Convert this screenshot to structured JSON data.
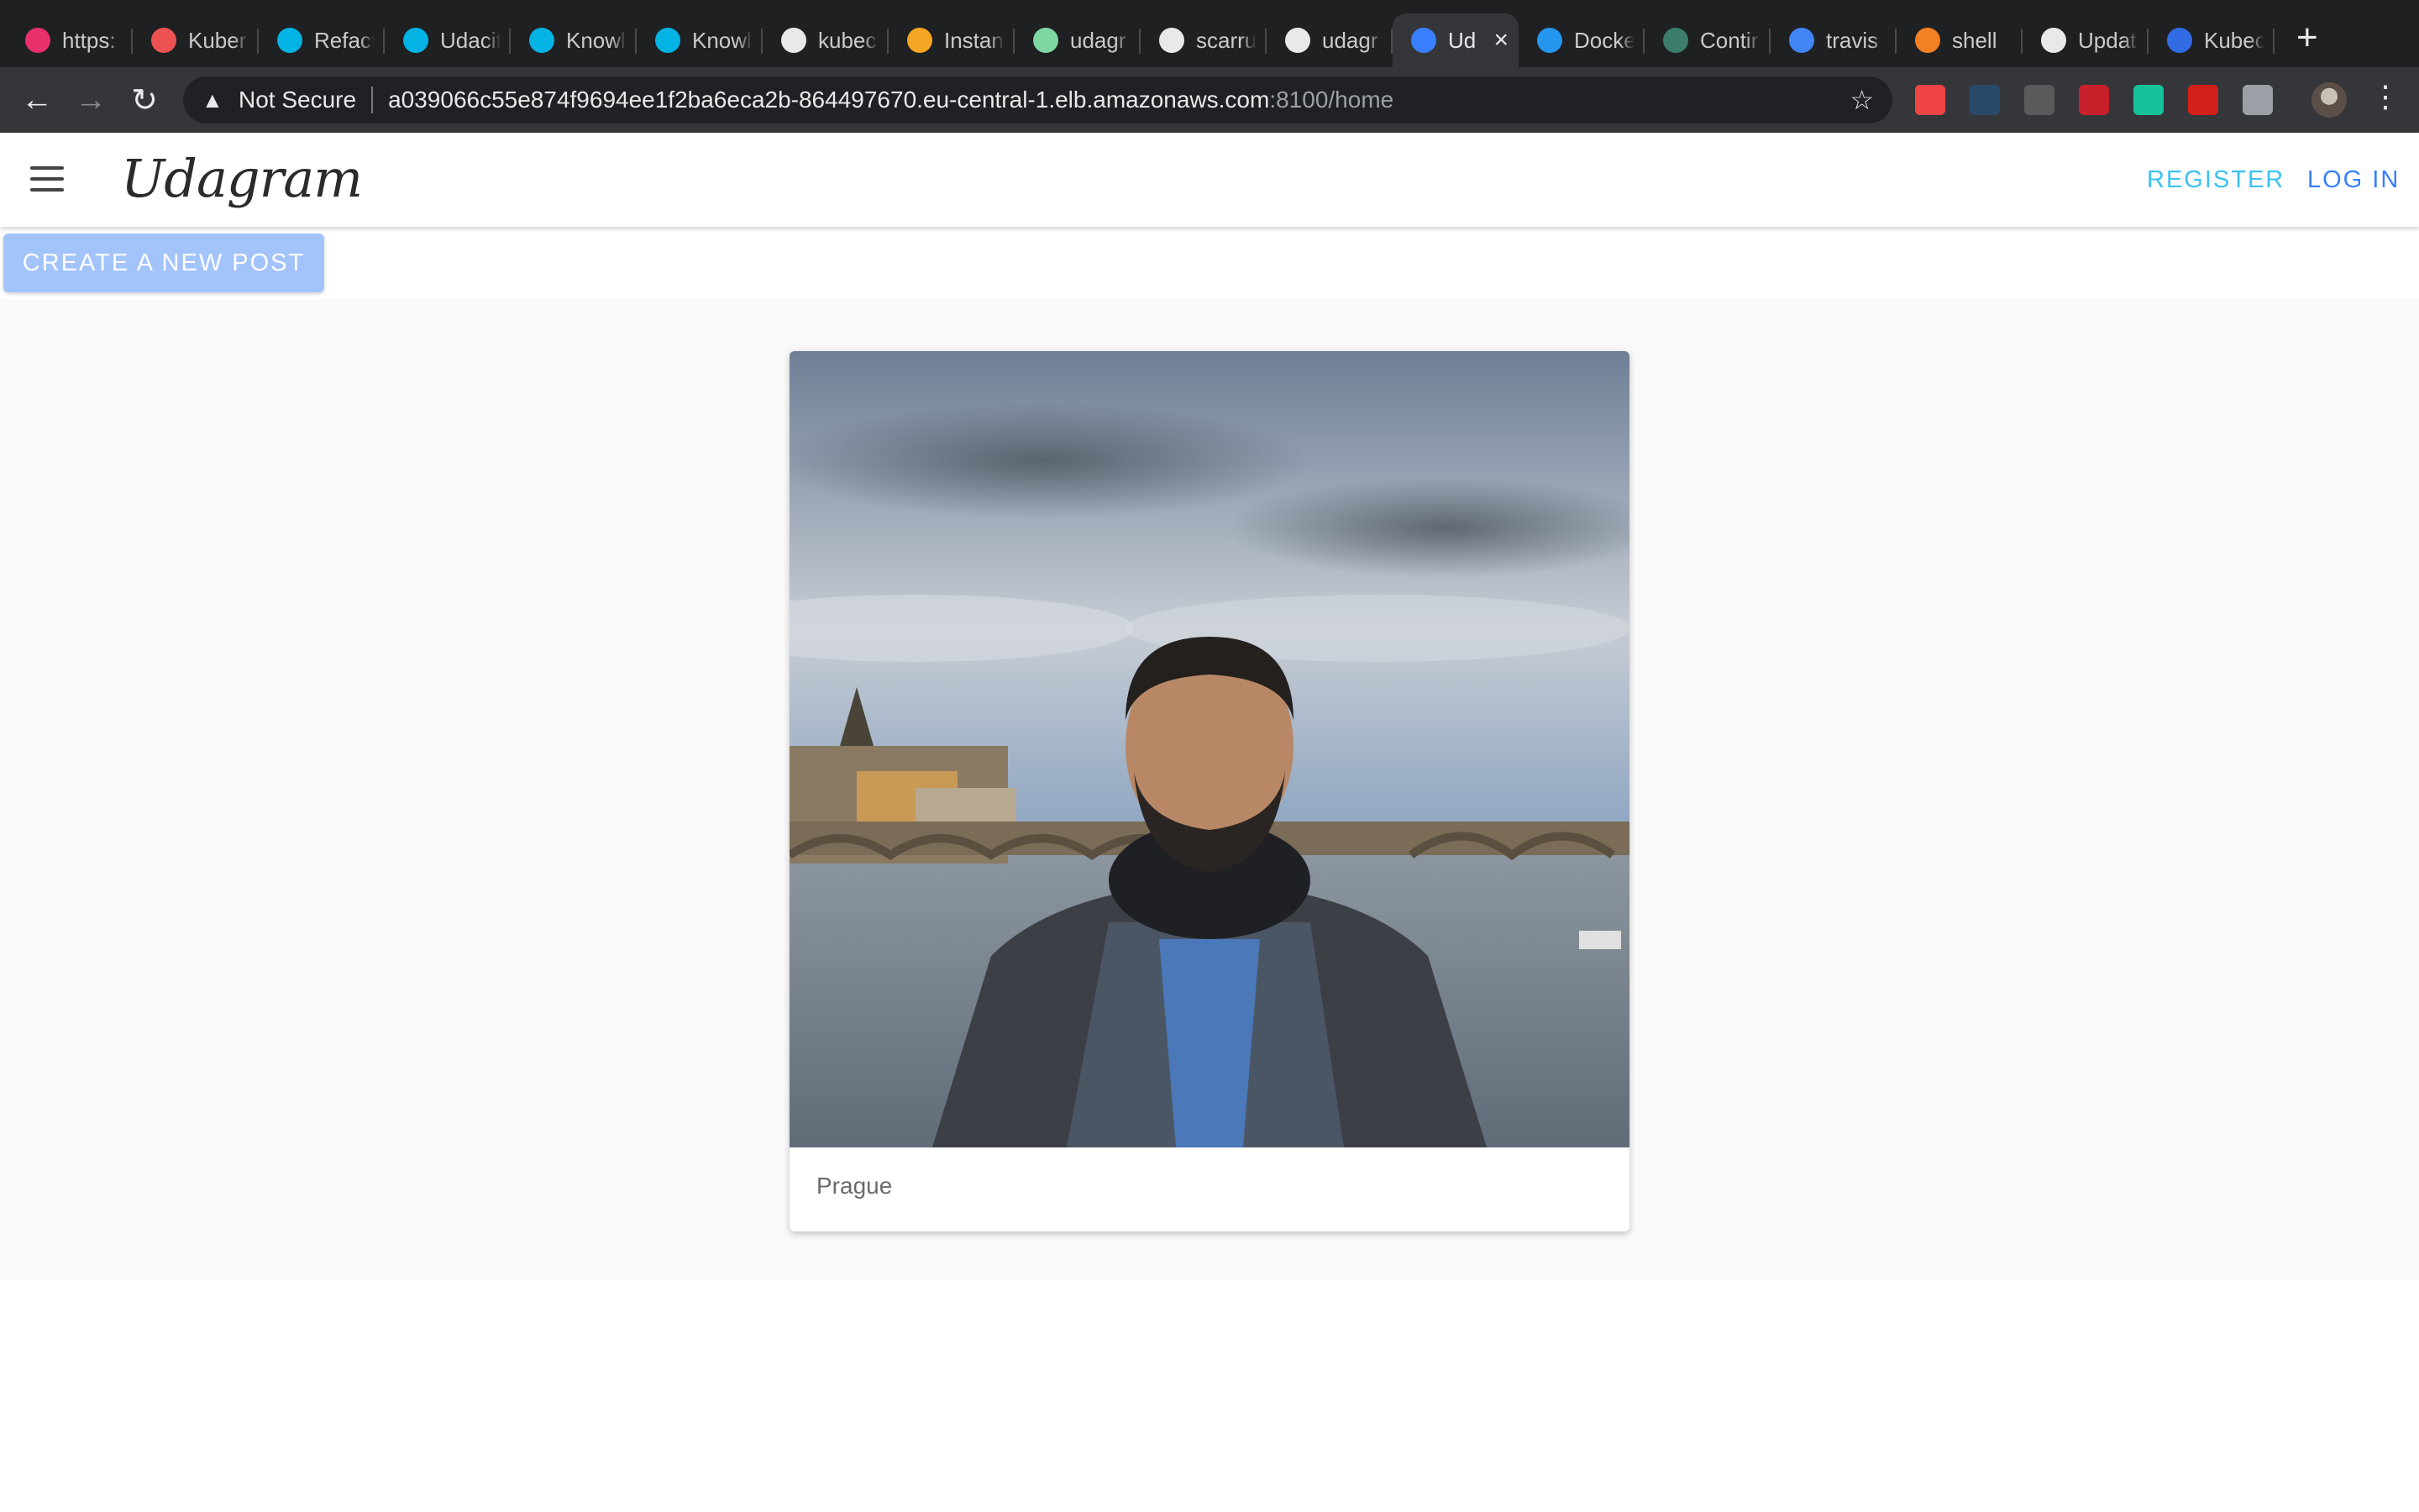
{
  "browser": {
    "tabs": [
      {
        "title": "https:",
        "icon": "r4r-icon",
        "color": "#e8306a"
      },
      {
        "title": "Kuber",
        "icon": "udemy-icon",
        "color": "#ec5252"
      },
      {
        "title": "Refact",
        "icon": "udacity-icon",
        "color": "#02b3e4"
      },
      {
        "title": "Udacit",
        "icon": "udacity-icon",
        "color": "#02b3e4"
      },
      {
        "title": "Knowl",
        "icon": "udacity-icon",
        "color": "#02b3e4"
      },
      {
        "title": "Knowl",
        "icon": "udacity-icon",
        "color": "#02b3e4"
      },
      {
        "title": "kubec",
        "icon": "github-icon",
        "color": "#e8e9eb"
      },
      {
        "title": "Instan",
        "icon": "aws-box-icon",
        "color": "#f5a623"
      },
      {
        "title": "udagr",
        "icon": "angular-icon",
        "color": "#7ed6a2"
      },
      {
        "title": "scarru",
        "icon": "github-icon",
        "color": "#e8e9eb"
      },
      {
        "title": "udagr",
        "icon": "github-icon",
        "color": "#e8e9eb"
      },
      {
        "title": "Ud",
        "icon": "ionic-icon",
        "color": "#3880ff",
        "active": true
      },
      {
        "title": "Docke",
        "icon": "docker-icon",
        "color": "#2496ed"
      },
      {
        "title": "Contir",
        "icon": "circleci-icon",
        "color": "#3c7d6b"
      },
      {
        "title": "travis",
        "icon": "google-icon",
        "color": "#4285f4"
      },
      {
        "title": "shell",
        "icon": "stackoverflow-icon",
        "color": "#f48024"
      },
      {
        "title": "Updat",
        "icon": "github-icon",
        "color": "#e8e9eb"
      },
      {
        "title": "Kubec",
        "icon": "kubernetes-icon",
        "color": "#326ce5"
      }
    ],
    "security_label": "Not Secure",
    "url_host": "a039066c55e874f9694ee1f2ba6eca2b-864497670.eu-central-1.elb.amazonaws.com",
    "url_rest": ":8100/home",
    "extensions": [
      {
        "icon": "color-wheel-icon",
        "color": "#e44"
      },
      {
        "icon": "udacity-icon",
        "color": "#2a4a6a"
      },
      {
        "icon": "facebook-icon",
        "color": "#5a5a5a"
      },
      {
        "icon": "cors-icon",
        "color": "#c8202a"
      },
      {
        "icon": "grammarly-icon",
        "color": "#15c39a"
      },
      {
        "icon": "acrobat-icon",
        "color": "#d3201b"
      },
      {
        "icon": "vue-devtools-icon",
        "color": "#9aa0a6"
      }
    ]
  },
  "app": {
    "logo": "Udagram",
    "register_label": "REGISTER",
    "login_label": "LOG IN",
    "create_post_label": "CREATE A NEW POST",
    "feed": [
      {
        "caption": "Prague"
      }
    ]
  }
}
